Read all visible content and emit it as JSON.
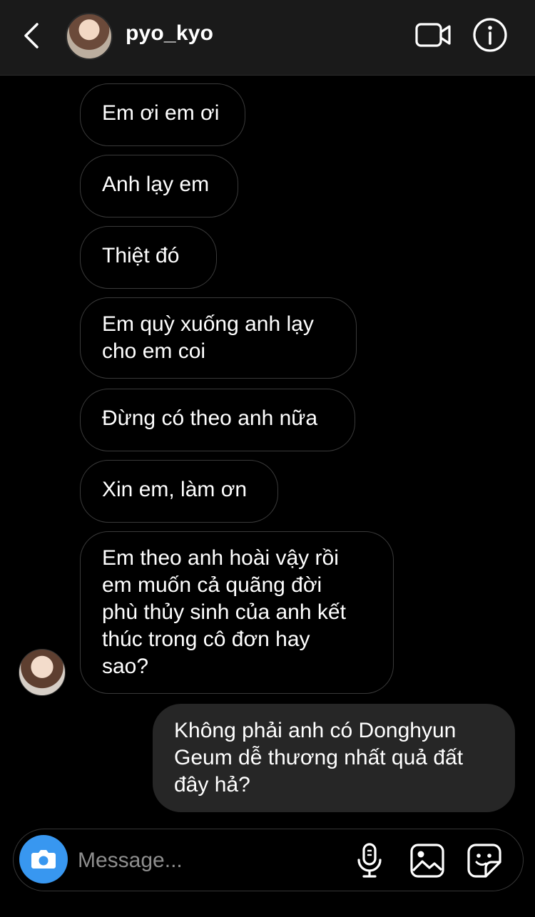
{
  "header": {
    "username": "pyo_kyo",
    "icons": [
      "back-icon",
      "profile-avatar",
      "video-call-icon",
      "info-icon"
    ]
  },
  "messages": [
    {
      "direction": "incoming",
      "text": "Em ơi em ơi"
    },
    {
      "direction": "incoming",
      "text": "Anh lạy em"
    },
    {
      "direction": "incoming",
      "text": "Thiệt đó"
    },
    {
      "direction": "incoming",
      "lines": [
        "Em quỳ xuống anh lạy",
        "cho em coi"
      ]
    },
    {
      "direction": "incoming",
      "text": "Đừng có theo anh nữa"
    },
    {
      "direction": "incoming",
      "text": "Xin em, làm ơn"
    },
    {
      "direction": "incoming",
      "lines": [
        "Em theo anh hoài vậy rồi",
        "em muốn cả quãng đời",
        "phù thủy sinh của anh kết",
        "thúc trong cô đơn hay",
        "sao?"
      ]
    },
    {
      "direction": "outgoing",
      "lines": [
        "Không phải anh có Donghyun",
        "Geum dễ thương nhất quả đất",
        "đây hả?"
      ]
    }
  ],
  "composer": {
    "placeholder": "Message...",
    "icons": [
      "camera-icon",
      "microphone-icon",
      "gallery-icon",
      "sticker-icon"
    ]
  },
  "colors": {
    "background": "#000000",
    "header": "#1a1a1a",
    "incoming_border": "#3a3a3a",
    "outgoing_bubble": "#262626",
    "camera_button": "#3897f0",
    "placeholder": "#8e8e8e"
  }
}
